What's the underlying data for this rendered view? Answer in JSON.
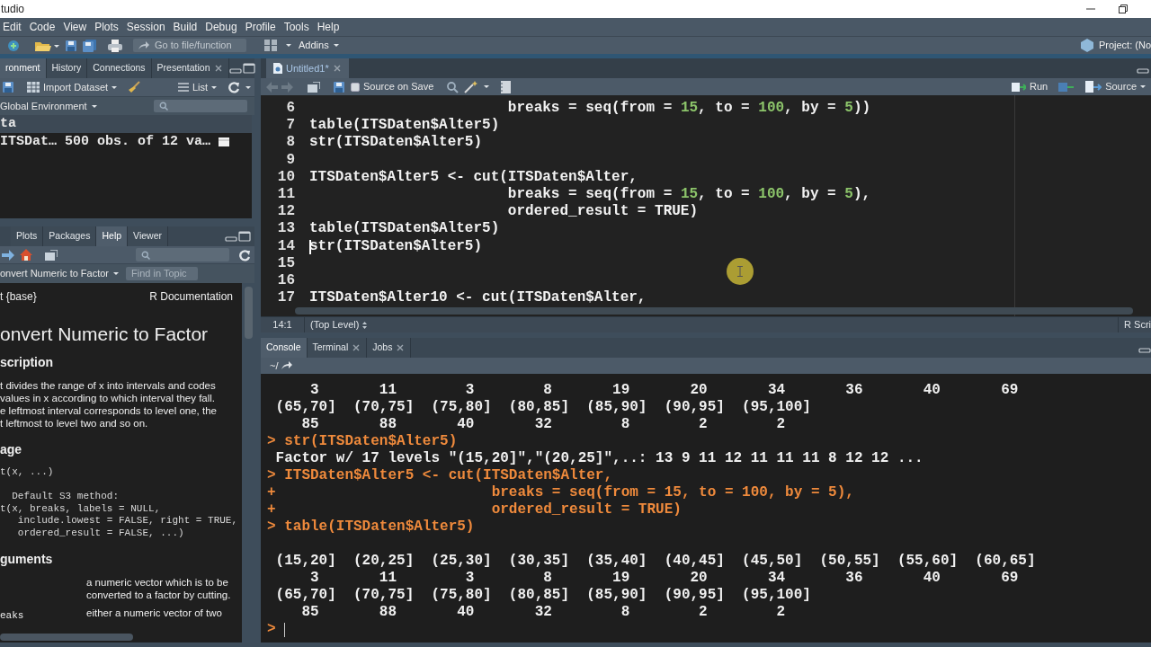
{
  "window": {
    "title": "tudio"
  },
  "menu": [
    "Edit",
    "Code",
    "View",
    "Plots",
    "Session",
    "Build",
    "Debug",
    "Profile",
    "Tools",
    "Help"
  ],
  "toolbar": {
    "goto_placeholder": "Go to file/function",
    "addins": "Addins",
    "project": "Project: (No"
  },
  "environment_pane": {
    "tabs": [
      {
        "label": "ronment",
        "selected": true,
        "closable": false
      },
      {
        "label": "History",
        "selected": false,
        "closable": false
      },
      {
        "label": "Connections",
        "selected": false,
        "closable": false
      },
      {
        "label": "Presentation",
        "selected": false,
        "closable": true
      }
    ],
    "import_label": "Import Dataset",
    "view_label": "List",
    "scope": "Global Environment",
    "section": "ta",
    "rows": [
      {
        "name": "ITSDat…",
        "value": "500 obs. of 12 va…"
      }
    ]
  },
  "help_pane": {
    "tabs": [
      {
        "label": "Plots",
        "selected": false
      },
      {
        "label": "Packages",
        "selected": false
      },
      {
        "label": "Help",
        "selected": true
      },
      {
        "label": "Viewer",
        "selected": false
      }
    ],
    "topic": "onvert Numeric to Factor",
    "find_placeholder": "Find in Topic",
    "package": "t {base}",
    "doc_label": "R Documentation",
    "title": "onvert Numeric to Factor",
    "sections": [
      {
        "kind": "heading",
        "text": "scription"
      },
      {
        "kind": "paragraph",
        "lines": [
          "t divides the range of x into intervals and codes",
          "values in x according to which interval they fall.",
          "e leftmost interval corresponds to level one, the",
          "t leftmost to level two and so on."
        ]
      },
      {
        "kind": "heading",
        "text": "age"
      },
      {
        "kind": "code",
        "blocks": [
          [
            "t(x, ...)"
          ],
          [
            "  Default S3 method:",
            "t(x, breaks, labels = NULL,",
            "   include.lowest = FALSE, right = TRUE,",
            "   ordered_result = FALSE, ...)"
          ]
        ]
      },
      {
        "kind": "heading",
        "text": "guments"
      },
      {
        "kind": "argument",
        "text": "a numeric vector which is to be converted to a factor by cutting."
      },
      {
        "kind": "argument",
        "name": "eaks",
        "text": "either a numeric vector of two"
      }
    ]
  },
  "editor": {
    "tabs": [
      {
        "label": "Untitled1*",
        "selected": true
      }
    ],
    "source_on_save": false,
    "source_on_save_label": "Source on Save",
    "run_label": "Run",
    "source_label": "Source",
    "lines": [
      {
        "number": "6",
        "cursor": false,
        "code": "                       breaks = seq(from = 15, to = 100, by = 5))"
      },
      {
        "number": "7",
        "cursor": false,
        "code": "table(ITSDaten$Alter5)"
      },
      {
        "number": "8",
        "cursor": false,
        "code": "str(ITSDaten$Alter5)"
      },
      {
        "number": "9",
        "cursor": false
      },
      {
        "number": "10",
        "cursor": false,
        "code": "ITSDaten$Alter5 <- cut(ITSDaten$Alter,"
      },
      {
        "number": "11",
        "cursor": false,
        "code": "                       breaks = seq(from = 15, to = 100, by = 5),"
      },
      {
        "number": "12",
        "cursor": false,
        "code": "                       ordered_result = TRUE)"
      },
      {
        "number": "13",
        "cursor": false,
        "code": "table(ITSDaten$Alter5)"
      },
      {
        "number": "14",
        "cursor": true,
        "code": "str(ITSDaten$Alter5)"
      },
      {
        "number": "15",
        "cursor": false
      },
      {
        "number": "16",
        "cursor": false
      },
      {
        "number": "17",
        "cursor": false,
        "code": "ITSDaten$Alter10 <- cut(ITSDaten$Alter,"
      }
    ],
    "position": "14:1",
    "scope": "(Top Level)",
    "file_type": "R Scri"
  },
  "console": {
    "tabs": [
      {
        "label": "Console",
        "selected": true,
        "closable": false
      },
      {
        "label": "Terminal",
        "selected": false,
        "closable": true
      },
      {
        "label": "Jobs",
        "selected": false,
        "closable": true
      }
    ],
    "path": "~/",
    "lines": [
      {
        "kind": "output",
        "text": "     3       11        3        8       19       20       34       36       40       69"
      },
      {
        "kind": "output",
        "text": " (65,70]  (70,75]  (75,80]  (80,85]  (85,90]  (90,95]  (95,100]"
      },
      {
        "kind": "output",
        "text": "    85       88       40       32        8        2        2"
      },
      {
        "kind": "input",
        "text": "> str(ITSDaten$Alter5)"
      },
      {
        "kind": "output",
        "text": " Factor w/ 17 levels \"(15,20]\",\"(20,25]\",..: 13 9 11 12 11 11 11 8 12 12 ..."
      },
      {
        "kind": "input",
        "text": "> ITSDaten$Alter5 <- cut(ITSDaten$Alter,"
      },
      {
        "kind": "input",
        "text": "+                         breaks = seq(from = 15, to = 100, by = 5),"
      },
      {
        "kind": "input",
        "text": "+                         ordered_result = TRUE)"
      },
      {
        "kind": "input",
        "text": "> table(ITSDaten$Alter5)"
      },
      {
        "kind": "blank"
      },
      {
        "kind": "output",
        "text": " (15,20]  (20,25]  (25,30]  (30,35]  (35,40]  (40,45]  (45,50]  (50,55]  (55,60]  (60,65]"
      },
      {
        "kind": "output",
        "text": "     3       11        3        8       19       20       34       36       40       69"
      },
      {
        "kind": "output",
        "text": " (65,70]  (70,75]  (75,80]  (80,85]  (85,90]  (90,95]  (95,100]"
      },
      {
        "kind": "output",
        "text": "    85       88       40       32        8        2        2"
      },
      {
        "kind": "prompt",
        "text": ">"
      }
    ]
  }
}
